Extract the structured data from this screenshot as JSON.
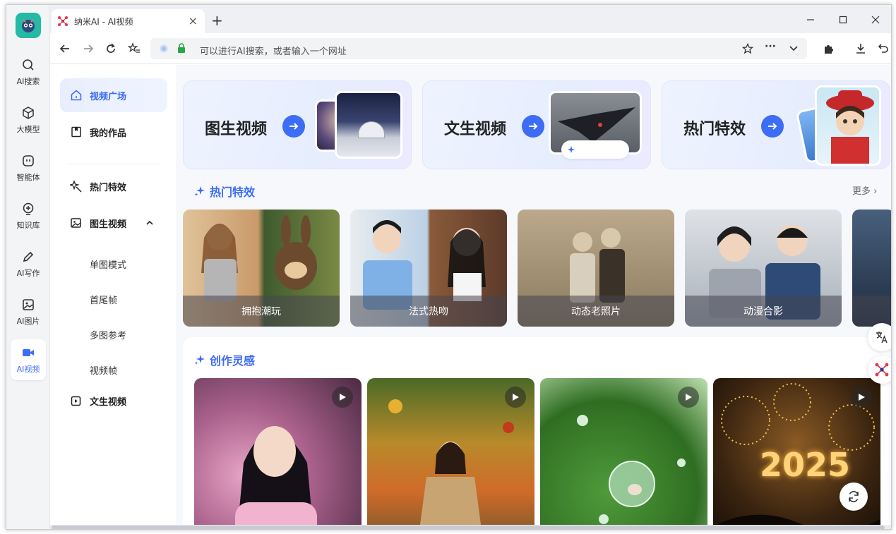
{
  "browser": {
    "tab_title": "纳米AI - AI视频",
    "tab_close": "×",
    "new_tab": "+",
    "address_placeholder": "可以进行AI搜索，或者输入一个网址",
    "address_more": "···"
  },
  "rail": {
    "items": [
      {
        "label": "AI搜索",
        "icon": "search-icon"
      },
      {
        "label": "大模型",
        "icon": "cube-icon"
      },
      {
        "label": "智能体",
        "icon": "agent-icon"
      },
      {
        "label": "知识库",
        "icon": "knowledge-icon"
      },
      {
        "label": "AI写作",
        "icon": "pen-icon"
      },
      {
        "label": "AI图片",
        "icon": "image-icon"
      },
      {
        "label": "AI视频",
        "icon": "video-icon",
        "active": true
      }
    ]
  },
  "sidenav": {
    "video_square": "视频广场",
    "my_works": "我的作品",
    "hot_effects": "热门特效",
    "image_to_video": "图生视频",
    "sub_items": [
      "单图模式",
      "首尾帧",
      "多图参考",
      "视频帧"
    ],
    "text_to_video": "文生视频"
  },
  "hero_cards": [
    {
      "label": "图生视频"
    },
    {
      "label": "文生视频"
    },
    {
      "label": "热门特效"
    }
  ],
  "hot_effects": {
    "title": "热门特效",
    "more": "更多 ›",
    "items": [
      "拥抱潮玩",
      "法式热吻",
      "动态老照片",
      "动漫合影"
    ]
  },
  "inspiration": {
    "title": "创作灵感",
    "fireworks_text": "2025"
  },
  "colors": {
    "accent": "#3d6cf6",
    "brand_logo": "#25b9a6"
  }
}
